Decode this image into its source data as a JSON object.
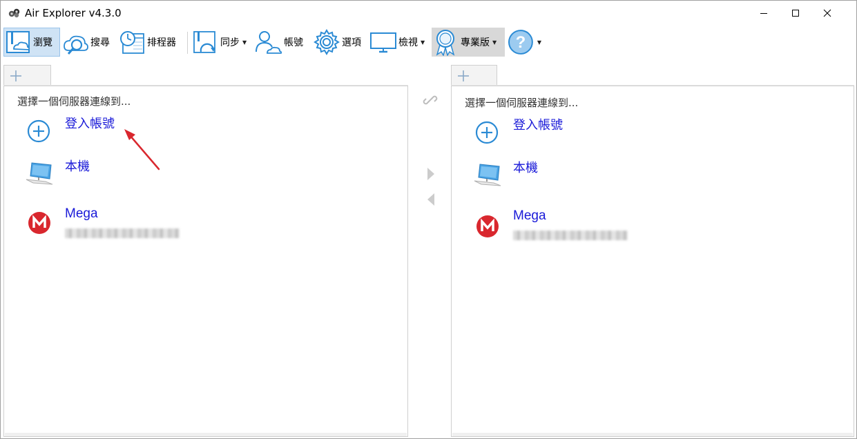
{
  "window": {
    "title": "Air Explorer v4.3.0"
  },
  "toolbar": {
    "browse": "瀏覽",
    "search": "搜尋",
    "scheduler": "排程器",
    "sync": "同步",
    "accounts": "帳號",
    "options": "選項",
    "view": "檢視",
    "pro": "專業版"
  },
  "left_pane": {
    "hint": "選擇一個伺服器連線到...",
    "items": [
      {
        "label": "登入帳號",
        "icon": "add-circle-icon"
      },
      {
        "label": "本機",
        "icon": "computer-icon"
      },
      {
        "label": "Mega",
        "icon": "mega-logo-icon"
      }
    ]
  },
  "right_pane": {
    "hint": "選擇一個伺服器連線到...",
    "items": [
      {
        "label": "登入帳號",
        "icon": "add-circle-icon"
      },
      {
        "label": "本機",
        "icon": "computer-icon"
      },
      {
        "label": "Mega",
        "icon": "mega-logo-icon"
      }
    ]
  },
  "colors": {
    "link": "#1a1ad8",
    "accent": "#2a8ad4",
    "mega": "#d9272e",
    "annotation_arrow": "#d9272e"
  }
}
